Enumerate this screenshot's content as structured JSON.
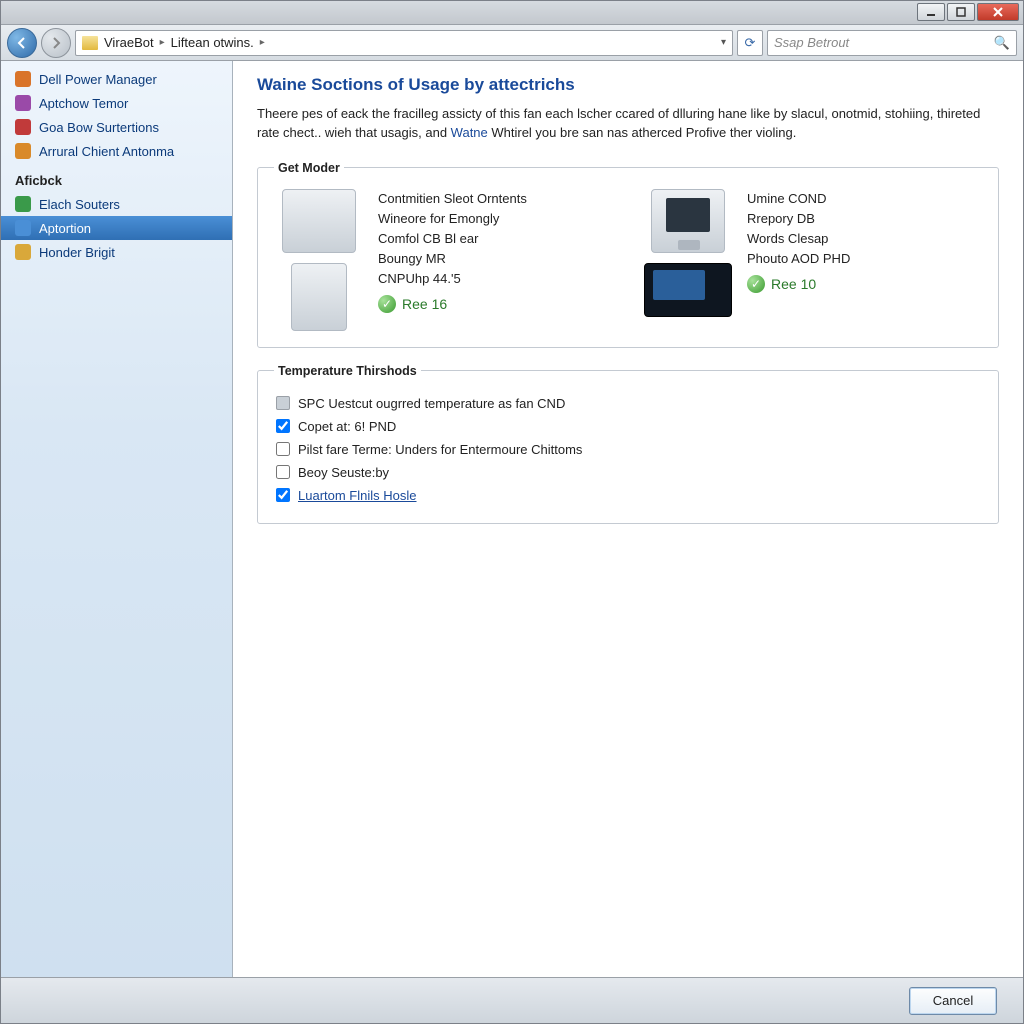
{
  "breadcrumb": {
    "seg1": "ViraeBot",
    "seg2": "Liftean otwins."
  },
  "search": {
    "placeholder": "Ssap Betrout"
  },
  "sidebar": {
    "group1": [
      {
        "label": "Dell Power Manager",
        "color": "#d9742a"
      },
      {
        "label": "Aptchow Temor",
        "color": "#9a4aa8"
      },
      {
        "label": "Goa Bow Surtertions",
        "color": "#c13a3a"
      },
      {
        "label": "Arrural Chient Antonma",
        "color": "#d98a2a"
      }
    ],
    "group2_head": "Aficbck",
    "group2": [
      {
        "label": "Elach Souters",
        "color": "#3a9a4a"
      },
      {
        "label": "Aptortion",
        "color": "#4a8fd6",
        "selected": true
      },
      {
        "label": "Honder Brigit",
        "color": "#d9a83a"
      }
    ]
  },
  "main": {
    "title": "Waine Soctions of Usage by attectrichs",
    "desc_pre": "Theere pes of eack the fracilleg assicty of this fan each lscher ccared of dlluring hane like by slacul, onotmid, stohiing, thireted rate chect.. wieh that usagis, and ",
    "desc_link": "Watne",
    "desc_post": " Whtirel you bre san nas atherced Profive ther violing."
  },
  "moder": {
    "legend": "Get Moder",
    "left": {
      "lines": [
        "Contmitien Sleot Orntents",
        "Wineore for Emongly",
        "Comfol CB Bl ear",
        "Boungy MR",
        "CNPUhp 44.'5"
      ],
      "status": "Ree 16"
    },
    "right": {
      "lines": [
        "Umine COND",
        "Rrepory DB",
        "Words Clesap",
        "Phouto AOD PHD"
      ],
      "status": "Ree 10"
    }
  },
  "thresholds": {
    "legend": "Temperature Thirshods",
    "items": [
      {
        "label": "SPC Uestcut ougrred temperature as fan CND",
        "checked": false,
        "icon": true
      },
      {
        "label": "Copet at: 6! PND",
        "checked": true
      },
      {
        "label": "Pilst fare Terme: Unders for Entermoure Chittoms",
        "checked": false
      },
      {
        "label": "Beoy Seuste:by",
        "checked": false
      },
      {
        "label": "Luartom Flnils Hosle",
        "checked": true,
        "link": true
      }
    ]
  },
  "buttons": {
    "cancel": "Cancel"
  }
}
